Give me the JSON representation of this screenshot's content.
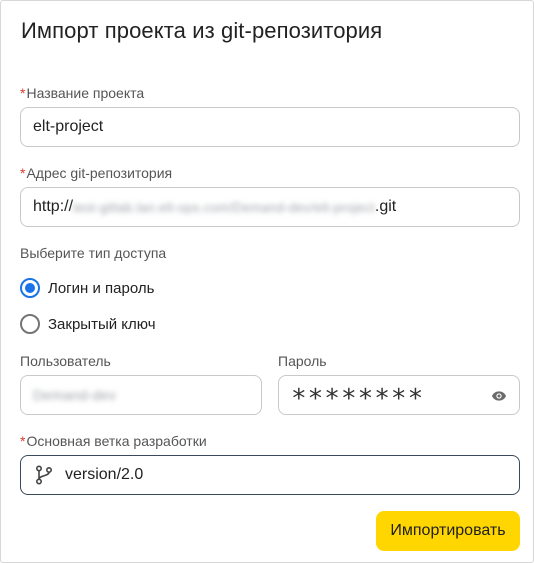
{
  "dialog": {
    "title": "Импорт проекта из git-репозитория"
  },
  "project_name": {
    "required_mark": "*",
    "label": "Название проекта",
    "value": "elt-project"
  },
  "repo_address": {
    "required_mark": "*",
    "label": "Адрес git-репозитория",
    "value_prefix": "http://",
    "value_blurred": "test-gitlab.lan.elt-ops.com/Demand-dev/elt-project",
    "value_suffix": ".git"
  },
  "access_type": {
    "label": "Выберите тип доступа",
    "options": [
      {
        "label": "Логин и пароль",
        "selected": true
      },
      {
        "label": "Закрытый ключ",
        "selected": false
      }
    ]
  },
  "user": {
    "label": "Пользователь",
    "value_blurred": "Demand-dev"
  },
  "password": {
    "label": "Пароль",
    "mask": "********",
    "icon": "eye-icon"
  },
  "branch": {
    "required_mark": "*",
    "label": "Основная ветка разработки",
    "value": "version/2.0",
    "icon": "git-branch-icon"
  },
  "actions": {
    "import_label": "Импортировать"
  },
  "colors": {
    "accent": "#ffd600",
    "radio": "#1a73e8",
    "required": "#d93a2f"
  }
}
